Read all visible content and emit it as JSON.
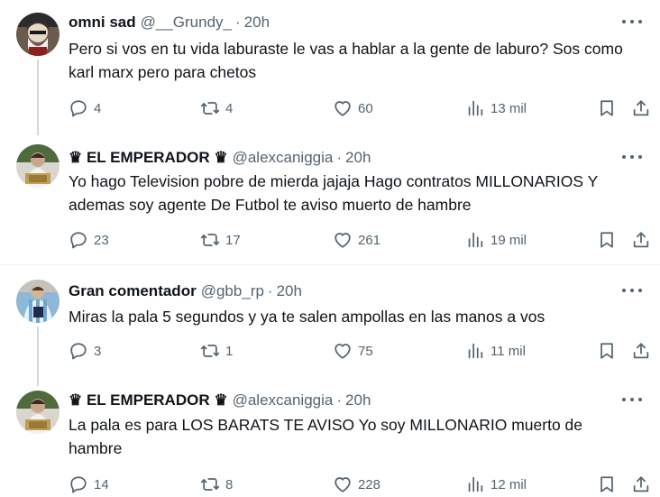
{
  "tweets": [
    {
      "name": "omni sad",
      "handle": "@__Grundy_",
      "separator": "·",
      "time": "20h",
      "text": "Pero si vos en tu vida laburaste le vas a hablar a la gente de laburo? Sos como karl marx pero para chetos",
      "replies": "4",
      "retweets": "4",
      "likes": "60",
      "views": "13 mil"
    },
    {
      "name": "♛ EL EMPERADOR ♛",
      "handle": "@alexcaniggia",
      "separator": "·",
      "time": "20h",
      "text": "Yo hago Television pobre de mierda jajaja Hago contratos MILLONARIOS Y ademas soy agente De Futbol te aviso muerto de hambre",
      "replies": "23",
      "retweets": "17",
      "likes": "261",
      "views": "19 mil"
    },
    {
      "name": "Gran comentador",
      "handle": "@gbb_rp",
      "separator": "·",
      "time": "20h",
      "text": "Miras la pala 5 segundos y ya te salen ampollas en las manos a vos",
      "replies": "3",
      "retweets": "1",
      "likes": "75",
      "views": "11 mil"
    },
    {
      "name": "♛ EL EMPERADOR ♛",
      "handle": "@alexcaniggia",
      "separator": "·",
      "time": "20h",
      "text": "La pala es para LOS BARATS TE AVISO Yo soy MILLONARIO muerto de hambre",
      "replies": "14",
      "retweets": "8",
      "likes": "228",
      "views": "12 mil"
    }
  ],
  "icons": {
    "reply": "reply-icon",
    "retweet": "retweet-icon",
    "like": "heart-icon",
    "views": "views-icon",
    "bookmark": "bookmark-icon",
    "share": "share-icon",
    "more": "more-icon"
  },
  "colors": {
    "text": "#0f1419",
    "secondary": "#536471",
    "thread_line": "#cfd9de",
    "divider": "#eff3f4"
  }
}
